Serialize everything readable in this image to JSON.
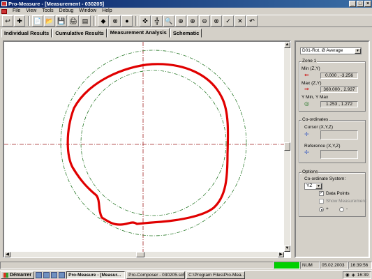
{
  "window": {
    "title": "Pro-Measure - [Measurement - 030205]"
  },
  "menu": [
    "File",
    "View",
    "Tools",
    "Debug",
    "Window",
    "Help"
  ],
  "toolbar": [
    "↩",
    "✚",
    "📄",
    "📂",
    "💾",
    "🖨",
    "▤",
    "◆",
    "⊗",
    "●",
    "✜",
    "╬",
    "🔍",
    "⊕",
    "⊕",
    "⊖",
    "⊗",
    "✓",
    "✕",
    "↶"
  ],
  "tabs": [
    "Individual Results",
    "Cumulative Results",
    "Measurement Analysis",
    "Schematic"
  ],
  "active_tab": 2,
  "panel": {
    "dropdown_value": "D01-Rot. Ø Average",
    "zone_title": "Zone 1",
    "min_label": "Min (Z,Y)",
    "min_value": "0.000 , -3.256",
    "max_label": "Max (Z,Y)",
    "max_value": "360.000 , 2.937",
    "ymin_ymax_label": "Y Min, Y Max",
    "ymin_ymax_value": "1.253 , 1.272",
    "coords_title": "Co-ordinates",
    "cursor_label": "Cursor (X,Y,Z)",
    "reference_label": "Reference (X,Y,Z)",
    "options_title": "Options",
    "coord_system_label": "Co-ordinate System:",
    "coord_system_value": "YZ",
    "data_points_label": "Data Points",
    "show_measurement_label": "Show Measurement",
    "radio_plus_label": "+",
    "radio_minus_label": "-"
  },
  "status": {
    "num": "NUM",
    "date": "05.02.2003",
    "time": "16:39:56"
  },
  "taskbar": {
    "start_label": "Démarrer",
    "tasks": [
      "Pro-Measure - [Measur...",
      "Pro-Composer - 030205.sch",
      "C:\\Program Files\\Pro-Mea..."
    ],
    "clock": "16:39"
  },
  "colors": {
    "trace": "#e00000",
    "zone": "#2a7a2a",
    "axis": "#a02020"
  }
}
